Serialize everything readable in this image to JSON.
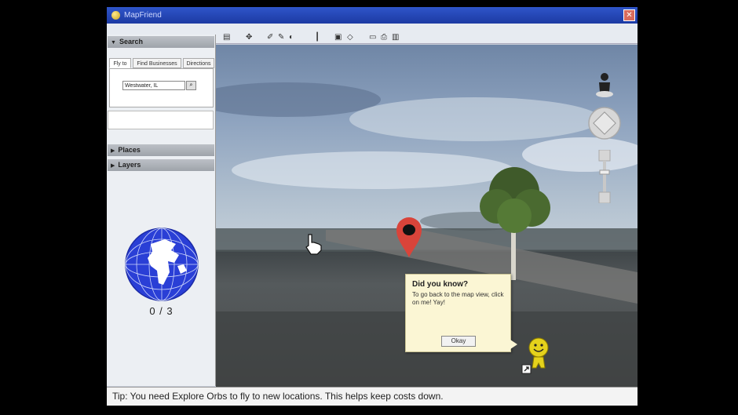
{
  "window": {
    "title": "MapFriend",
    "close_glyph": "✕"
  },
  "toolbar": {
    "buttons": [
      "▤",
      "✥",
      "✐",
      "✎",
      "◐",
      "┃",
      "▣",
      "◇",
      "▭",
      "⎙",
      "▥"
    ]
  },
  "sidebar": {
    "search": {
      "header": "Search",
      "tabs": [
        "Fly to",
        "Find Businesses",
        "Directions"
      ],
      "input_value": "Westwater, IL",
      "button_glyph": "⌕"
    },
    "places_header": "Places",
    "layers_header": "Layers",
    "orb_count": "0 / 3"
  },
  "tooltip": {
    "title": "Did you know?",
    "body": "To go back to the map view, click on me! Yay!",
    "ok_label": "Okay"
  },
  "status": {
    "tip": "Tip: You need Explore Orbs to fly to new locations. This helps keep costs down."
  },
  "colors": {
    "titlebar": "#1c3aa3",
    "globe": "#2a3fd6",
    "pin": "#d9443a",
    "mascot": "#e5d21c"
  }
}
